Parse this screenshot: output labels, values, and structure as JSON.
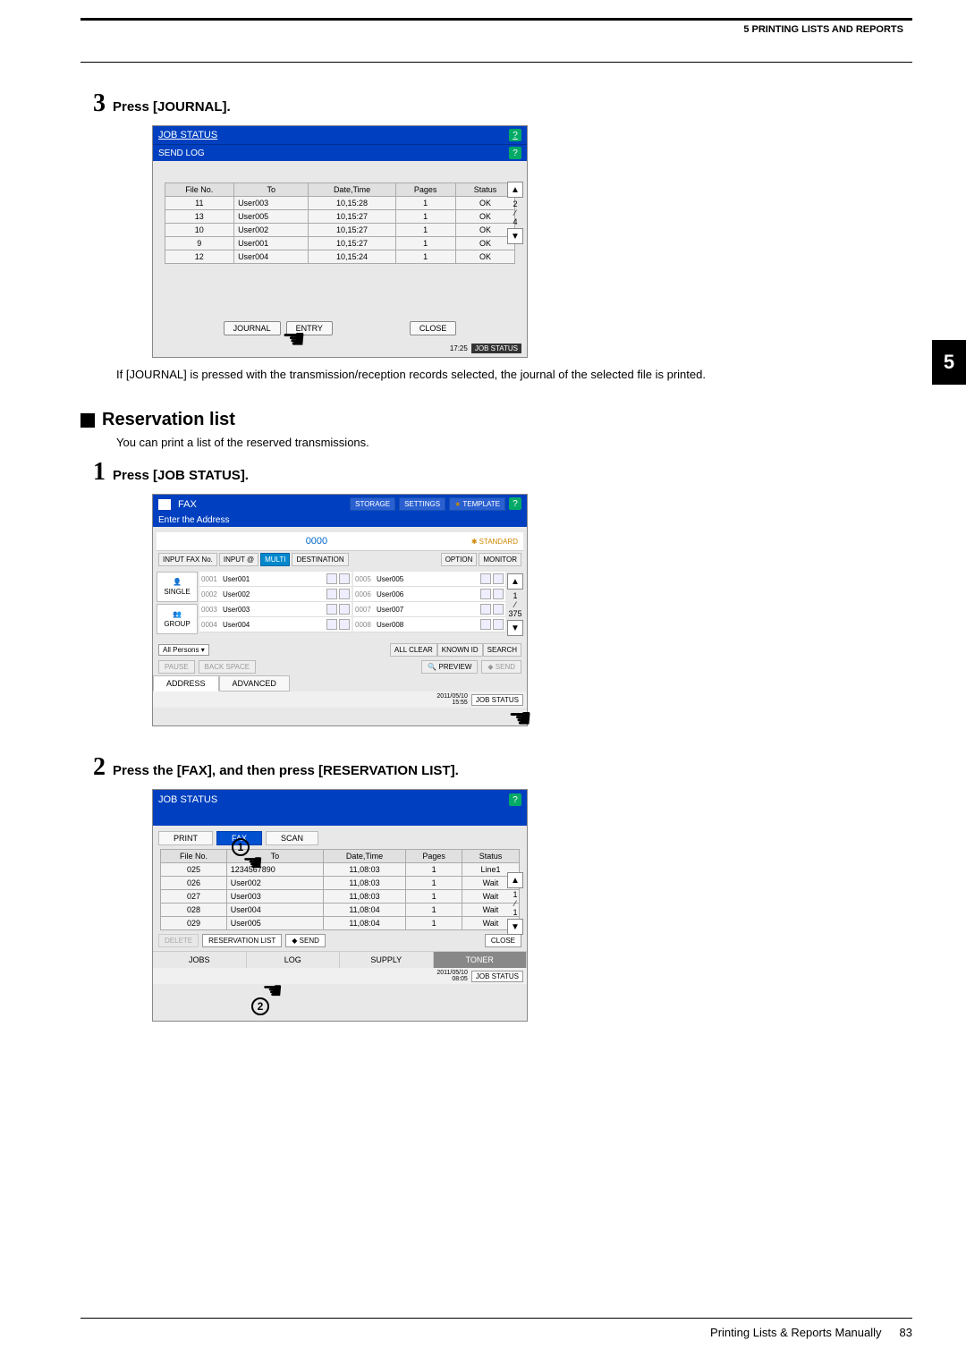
{
  "header": {
    "chapter": "5 PRINTING LISTS AND REPORTS"
  },
  "side_tab": "5",
  "step3": {
    "num": "3",
    "txt": "Press [JOURNAL]."
  },
  "shot1": {
    "title": "JOB STATUS",
    "subtitle": "SEND LOG",
    "cols": {
      "fileno": "File No.",
      "to": "To",
      "datetime": "Date,Time",
      "pages": "Pages",
      "status": "Status"
    },
    "rows": [
      {
        "no": "11",
        "to": "User003",
        "dt": "10,15:28",
        "pg": "1",
        "st": "OK"
      },
      {
        "no": "13",
        "to": "User005",
        "dt": "10,15:27",
        "pg": "1",
        "st": "OK"
      },
      {
        "no": "10",
        "to": "User002",
        "dt": "10,15:27",
        "pg": "1",
        "st": "OK"
      },
      {
        "no": "9",
        "to": "User001",
        "dt": "10,15:27",
        "pg": "1",
        "st": "OK"
      },
      {
        "no": "12",
        "to": "User004",
        "dt": "10,15:24",
        "pg": "1",
        "st": "OK"
      }
    ],
    "frac_top": "2",
    "frac_bot": "4",
    "btn_journal": "JOURNAL",
    "btn_entry": "ENTRY",
    "btn_close": "CLOSE",
    "time": "17:25",
    "jobstatus": "JOB STATUS"
  },
  "note1": "If [JOURNAL] is pressed with the transmission/reception records selected, the journal of the selected file is printed.",
  "section2": {
    "title": "Reservation list",
    "intro": "You can print a list of the reserved transmissions."
  },
  "step1": {
    "num": "1",
    "txt": "Press [JOB STATUS]."
  },
  "shot2": {
    "title": "FAX",
    "top_btns": {
      "storage": "STORAGE",
      "settings": "SETTINGS",
      "template": "TEMPLATE"
    },
    "enter": "Enter the Address",
    "zeros": "0000",
    "standard": "STANDARD",
    "row_btns": {
      "inputfax": "INPUT FAX No.",
      "inputat": "INPUT @",
      "multi": "MULTI",
      "dest": "DESTINATION",
      "option": "OPTION",
      "monitor": "MONITOR"
    },
    "lt_single": "SINGLE",
    "lt_group": "GROUP",
    "addrs_left": [
      {
        "n": "0001",
        "name": "User001"
      },
      {
        "n": "0002",
        "name": "User002"
      },
      {
        "n": "0003",
        "name": "User003"
      },
      {
        "n": "0004",
        "name": "User004"
      }
    ],
    "addrs_right": [
      {
        "n": "0005",
        "name": "User005"
      },
      {
        "n": "0006",
        "name": "User006"
      },
      {
        "n": "0007",
        "name": "User007"
      },
      {
        "n": "0008",
        "name": "User008"
      }
    ],
    "frac_top": "1",
    "frac_bot": "375",
    "allpersons": "All Persons",
    "allclear": "ALL CLEAR",
    "knownid": "KNOWN ID",
    "search": "SEARCH",
    "pause": "PAUSE",
    "backspace": "BACK SPACE",
    "preview": "PREVIEW",
    "send": "SEND",
    "tab_addr": "ADDRESS",
    "tab_adv": "ADVANCED",
    "date": "2011/05/10\n15:55",
    "jobstatus": "JOB STATUS"
  },
  "step2": {
    "num": "2",
    "txt": "Press the [FAX], and then press [RESERVATION LIST]."
  },
  "shot3": {
    "title": "JOB STATUS",
    "pfs": {
      "print": "PRINT",
      "fax": "FAX",
      "scan": "SCAN"
    },
    "cols": {
      "fileno": "File No.",
      "to": "To",
      "datetime": "Date,Time",
      "pages": "Pages",
      "status": "Status"
    },
    "rows": [
      {
        "no": "025",
        "to": "1234567890",
        "dt": "11,08:03",
        "pg": "1",
        "st": "Line1"
      },
      {
        "no": "026",
        "to": "User002",
        "dt": "11,08:03",
        "pg": "1",
        "st": "Wait"
      },
      {
        "no": "027",
        "to": "User003",
        "dt": "11,08:03",
        "pg": "1",
        "st": "Wait"
      },
      {
        "no": "028",
        "to": "User004",
        "dt": "11,08:04",
        "pg": "1",
        "st": "Wait"
      },
      {
        "no": "029",
        "to": "User005",
        "dt": "11,08:04",
        "pg": "1",
        "st": "Wait"
      }
    ],
    "frac_top": "1",
    "frac_bot": "1",
    "delete": "DELETE",
    "reslist": "RESERVATION LIST",
    "send": "SEND",
    "close": "CLOSE",
    "jt": {
      "jobs": "JOBS",
      "log": "LOG",
      "supply": "SUPPLY",
      "toner": "TONER"
    },
    "date": "2011/05/10\n08:05",
    "jobstatus": "JOB STATUS"
  },
  "annot": {
    "c1": "1",
    "c2": "2"
  },
  "footer": {
    "txt": "Printing Lists & Reports Manually",
    "page": "83"
  }
}
